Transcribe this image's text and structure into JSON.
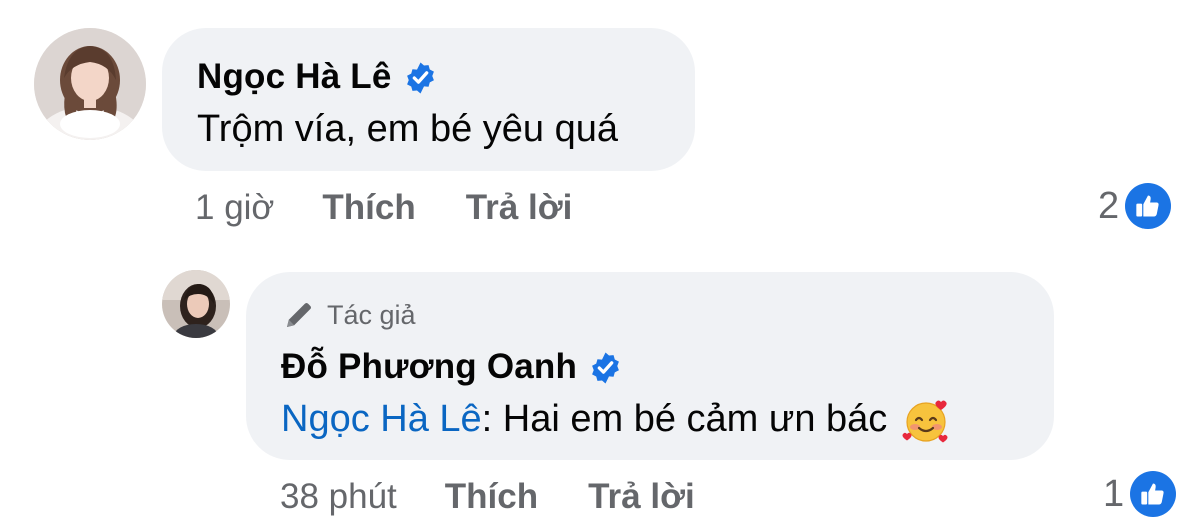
{
  "comment": {
    "author": "Ngọc Hà Lê",
    "text": "Trộm vía, em bé yêu quá",
    "time": "1 giờ",
    "like_label": "Thích",
    "reply_label": "Trả lời",
    "reaction_count": "2",
    "reaction_icon": "thumbs-up-icon"
  },
  "reply": {
    "badge_label": "Tác giả",
    "badge_icon": "pencil-icon",
    "author": "Đỗ Phương Oanh",
    "mention": "Ngọc Hà Lê",
    "separator": ":",
    "text": " Hai em bé cảm ưn bác",
    "emoji": "smiling-face-with-hearts-emoji",
    "time": "38 phút",
    "like_label": "Thích",
    "reply_label": "Trả lời",
    "reaction_count": "1",
    "reaction_icon": "thumbs-up-icon"
  },
  "colors": {
    "bubble": "#f0f2f5",
    "meta_text": "#65676b",
    "mention": "#0a66c2",
    "like_badge": "#1b74e4",
    "verified": "#1b74e4"
  }
}
